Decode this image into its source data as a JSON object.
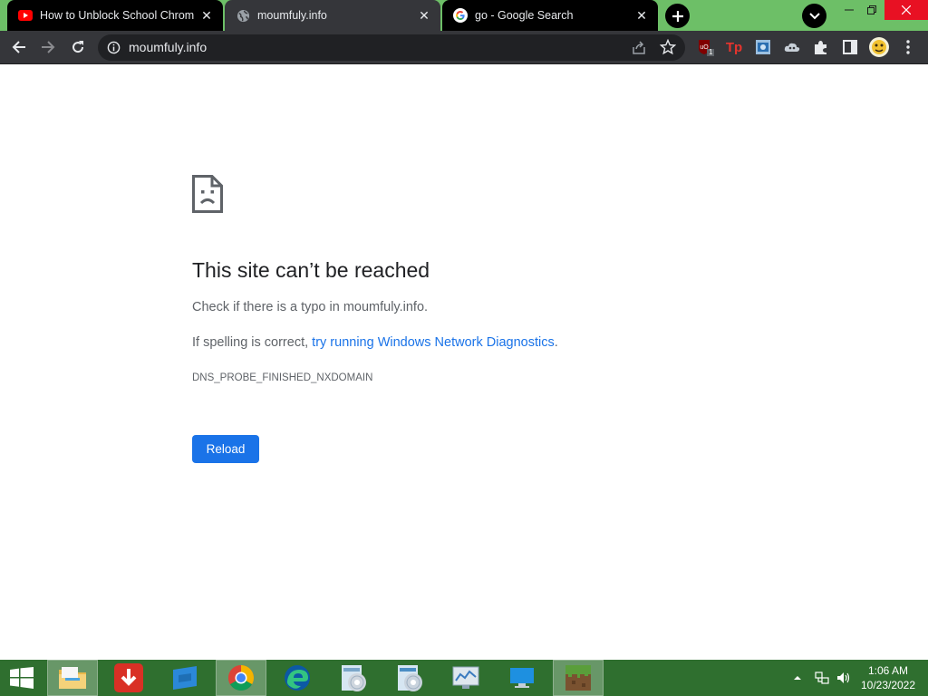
{
  "tabs": [
    {
      "title": "How to Unblock School Chromeb",
      "favicon": "youtube-icon"
    },
    {
      "title": "moumfuly.info",
      "favicon": "globe-icon"
    },
    {
      "title": "go - Google Search",
      "favicon": "google-icon"
    }
  ],
  "omnibox": {
    "url": "moumfuly.info"
  },
  "extensions": {
    "ublock_badge": "1",
    "tp_label": "Tp"
  },
  "error": {
    "title": "This site can’t be reached",
    "line1": "Check if there is a typo in moumfuly.info.",
    "line2_prefix": "If spelling is correct, ",
    "line2_link": "try running Windows Network Diagnostics",
    "line2_suffix": ".",
    "code": "DNS_PROBE_FINISHED_NXDOMAIN",
    "reload_label": "Reload"
  },
  "taskbar": {
    "time": "1:06 AM",
    "date": "10/23/2022",
    "apps": [
      "windows-start-icon",
      "file-explorer-icon",
      "download-icon",
      "windows-store-icon",
      "chrome-icon",
      "edge-icon",
      "disc-app-icon",
      "disc-app-2-icon",
      "monitor-app-icon",
      "display-icon",
      "minecraft-icon"
    ]
  },
  "colors": {
    "accent": "#1a73e8",
    "tabstrip": "#6dbf67",
    "taskbar": "#2f6f2f",
    "toolbar": "#35363a"
  }
}
